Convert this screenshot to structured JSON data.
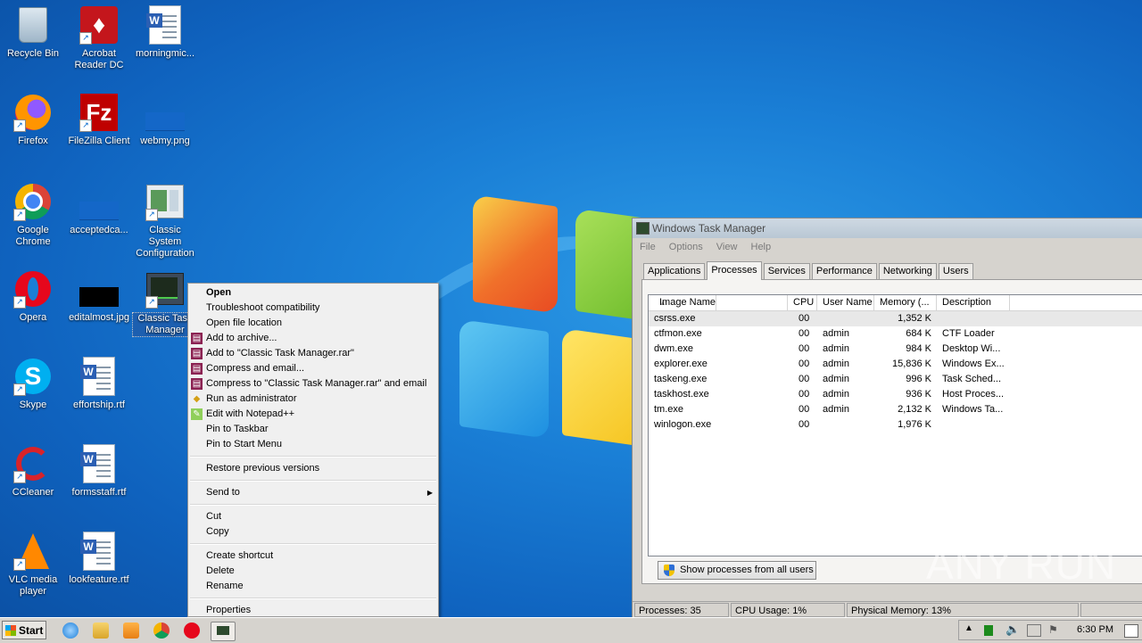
{
  "desktop": {
    "icons": [
      {
        "label": "Recycle Bin",
        "icon": "recycle-bin-icon"
      },
      {
        "label": "Acrobat Reader DC",
        "icon": "acrobat-icon"
      },
      {
        "label": "morningmic...",
        "icon": "word-doc-icon"
      },
      {
        "label": "Firefox",
        "icon": "firefox-icon"
      },
      {
        "label": "FileZilla Client",
        "icon": "filezilla-icon"
      },
      {
        "label": "webmy.png",
        "icon": "image-file-icon"
      },
      {
        "label": "Google Chrome",
        "icon": "chrome-icon"
      },
      {
        "label": "acceptedca...",
        "icon": "image-file-icon"
      },
      {
        "label": "Classic System Configuration",
        "icon": "system-config-icon"
      },
      {
        "label": "Opera",
        "icon": "opera-icon"
      },
      {
        "label": "editalmost.jpg",
        "icon": "image-file-icon"
      },
      {
        "label": "Classic Task Manager",
        "icon": "task-manager-icon"
      },
      {
        "label": "Skype",
        "icon": "skype-icon"
      },
      {
        "label": "effortship.rtf",
        "icon": "word-doc-icon"
      },
      {
        "label": "CCleaner",
        "icon": "ccleaner-icon"
      },
      {
        "label": "formsstaff.rtf",
        "icon": "word-doc-icon"
      },
      {
        "label": "VLC media player",
        "icon": "vlc-icon"
      },
      {
        "label": "lookfeature.rtf",
        "icon": "word-doc-icon"
      }
    ]
  },
  "context_menu": {
    "items": [
      {
        "label": "Open"
      },
      {
        "label": "Troubleshoot compatibility"
      },
      {
        "label": "Open file location"
      },
      {
        "label": "Add to archive..."
      },
      {
        "label": "Add to \"Classic Task Manager.rar\""
      },
      {
        "label": "Compress and email..."
      },
      {
        "label": "Compress to \"Classic Task Manager.rar\" and email"
      },
      {
        "label": "Run as administrator"
      },
      {
        "label": "Edit with Notepad++"
      },
      {
        "label": "Pin to Taskbar"
      },
      {
        "label": "Pin to Start Menu"
      },
      {
        "label": "Restore previous versions"
      },
      {
        "label": "Send to"
      },
      {
        "label": "Cut"
      },
      {
        "label": "Copy"
      },
      {
        "label": "Create shortcut"
      },
      {
        "label": "Delete"
      },
      {
        "label": "Rename"
      },
      {
        "label": "Properties"
      }
    ]
  },
  "task_manager": {
    "title": "Windows Task Manager",
    "menu": [
      "File",
      "Options",
      "View",
      "Help"
    ],
    "tabs": [
      "Applications",
      "Processes",
      "Services",
      "Performance",
      "Networking",
      "Users"
    ],
    "active_tab": "Processes",
    "columns": [
      "Image Name",
      "CPU",
      "User Name",
      "Memory (...",
      "Description"
    ],
    "rows": [
      {
        "name": "csrss.exe",
        "cpu": "00",
        "user": "",
        "mem": "1,352 K",
        "desc": ""
      },
      {
        "name": "ctfmon.exe",
        "cpu": "00",
        "user": "admin",
        "mem": "684 K",
        "desc": "CTF Loader"
      },
      {
        "name": "dwm.exe",
        "cpu": "00",
        "user": "admin",
        "mem": "984 K",
        "desc": "Desktop Wi..."
      },
      {
        "name": "explorer.exe",
        "cpu": "00",
        "user": "admin",
        "mem": "15,836 K",
        "desc": "Windows Ex..."
      },
      {
        "name": "taskeng.exe",
        "cpu": "00",
        "user": "admin",
        "mem": "996 K",
        "desc": "Task Sched..."
      },
      {
        "name": "taskhost.exe",
        "cpu": "00",
        "user": "admin",
        "mem": "936 K",
        "desc": "Host Proces..."
      },
      {
        "name": "tm.exe",
        "cpu": "00",
        "user": "admin",
        "mem": "2,132 K",
        "desc": "Windows Ta..."
      },
      {
        "name": "winlogon.exe",
        "cpu": "00",
        "user": "",
        "mem": "1,976 K",
        "desc": ""
      }
    ],
    "show_all_button": "Show processes from all users",
    "status": {
      "processes": "Processes: 35",
      "cpu": "CPU Usage: 1%",
      "memory": "Physical Memory: 13%"
    }
  },
  "watermark": "ANY RUN",
  "taskbar": {
    "start_label": "Start",
    "clock": "6:30 PM"
  }
}
